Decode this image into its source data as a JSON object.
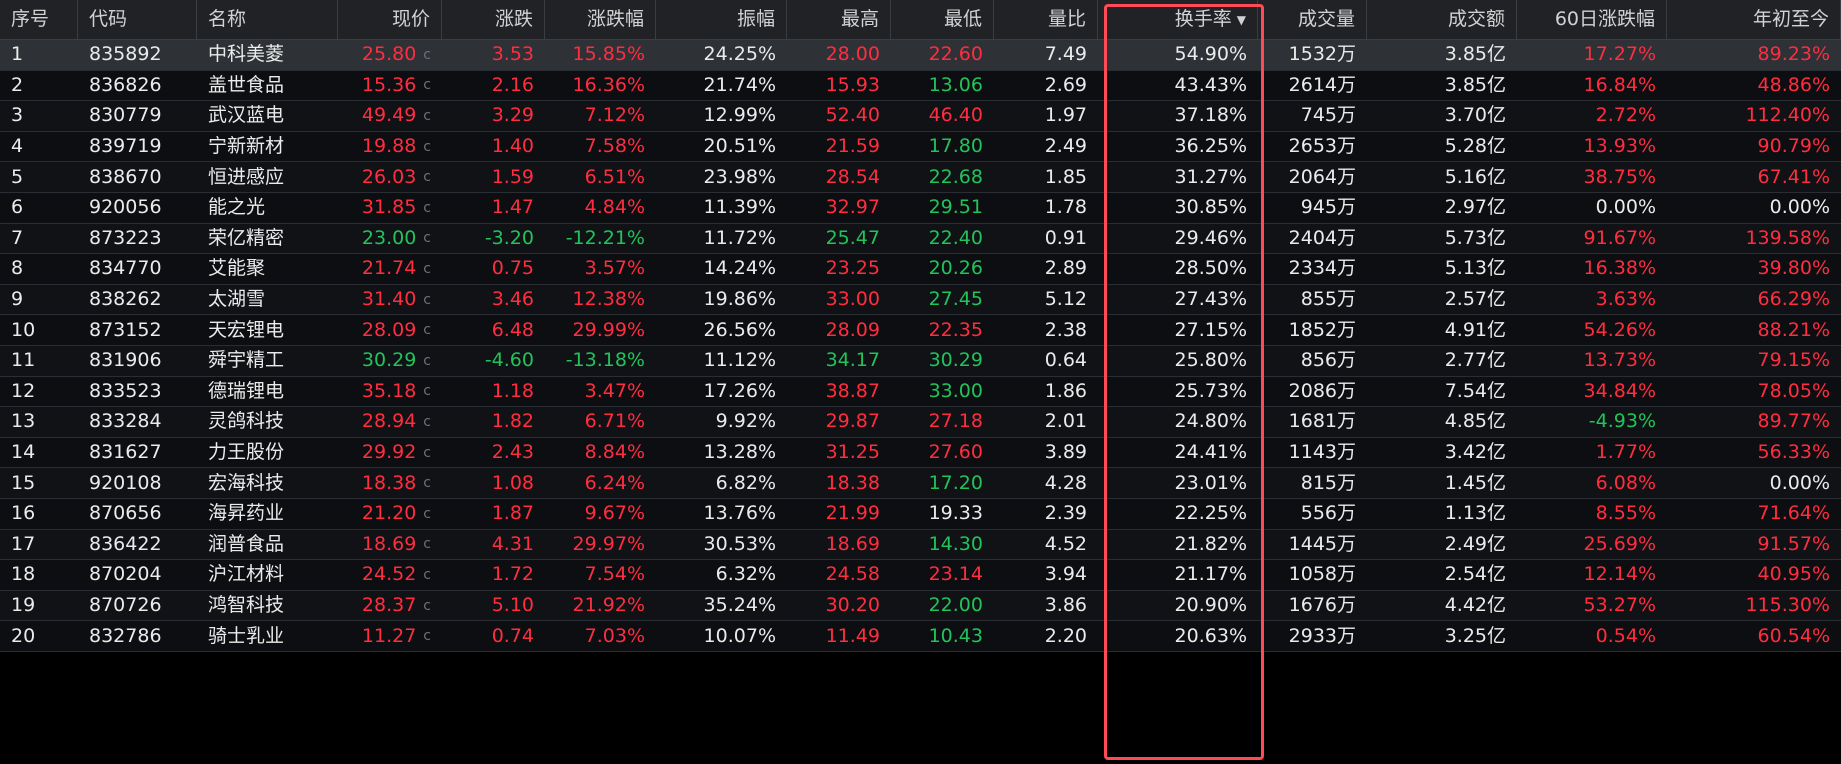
{
  "columns": [
    {
      "key": "seq",
      "label": "序号",
      "align": "l",
      "w": 78
    },
    {
      "key": "code",
      "label": "代码",
      "align": "l",
      "w": 119
    },
    {
      "key": "name",
      "label": "名称",
      "align": "l",
      "w": 141
    },
    {
      "key": "price",
      "label": "现价",
      "align": "r",
      "w": 104
    },
    {
      "key": "chg",
      "label": "涨跌",
      "align": "r",
      "w": 103
    },
    {
      "key": "pct",
      "label": "涨跌幅",
      "align": "r",
      "w": 111
    },
    {
      "key": "amp",
      "label": "振幅",
      "align": "r",
      "w": 131
    },
    {
      "key": "high",
      "label": "最高",
      "align": "r",
      "w": 104
    },
    {
      "key": "low",
      "label": "最低",
      "align": "r",
      "w": 103
    },
    {
      "key": "vr",
      "label": "量比",
      "align": "r",
      "w": 104
    },
    {
      "key": "turn",
      "label": "换手率",
      "align": "r",
      "w": 160,
      "sorted": true,
      "sort_arrow": "▼"
    },
    {
      "key": "vol",
      "label": "成交量",
      "align": "r",
      "w": 109
    },
    {
      "key": "amt",
      "label": "成交额",
      "align": "r",
      "w": 150
    },
    {
      "key": "d60",
      "label": "60日涨跌幅",
      "align": "r",
      "w": 150
    },
    {
      "key": "ytd",
      "label": "年初至今",
      "align": "r",
      "w": 174
    }
  ],
  "price_suffix": "c",
  "selected_row": 0,
  "colors": {
    "up": "#ff2d3f",
    "down": "#21c35a",
    "flat": "#ebebeb",
    "highlight_box": "#ff4a57"
  },
  "rows": [
    {
      "seq": "1",
      "code": "835892",
      "name": "中科美菱",
      "price": "25.80",
      "chg": "3.53",
      "pct": "15.85%",
      "amp": "24.25%",
      "high": "28.00",
      "low": "22.60",
      "vr": "7.49",
      "turn": "54.90%",
      "vol": "1532万",
      "amt": "3.85亿",
      "d60": "17.27%",
      "ytd": "89.23%"
    },
    {
      "seq": "2",
      "code": "836826",
      "name": "盖世食品",
      "price": "15.36",
      "chg": "2.16",
      "pct": "16.36%",
      "amp": "21.74%",
      "high": "15.93",
      "low": "13.06",
      "vr": "2.69",
      "turn": "43.43%",
      "vol": "2614万",
      "amt": "3.85亿",
      "d60": "16.84%",
      "ytd": "48.86%"
    },
    {
      "seq": "3",
      "code": "830779",
      "name": "武汉蓝电",
      "price": "49.49",
      "chg": "3.29",
      "pct": "7.12%",
      "amp": "12.99%",
      "high": "52.40",
      "low": "46.40",
      "vr": "1.97",
      "turn": "37.18%",
      "vol": "745万",
      "amt": "3.70亿",
      "d60": "2.72%",
      "ytd": "112.40%"
    },
    {
      "seq": "4",
      "code": "839719",
      "name": "宁新新材",
      "price": "19.88",
      "chg": "1.40",
      "pct": "7.58%",
      "amp": "20.51%",
      "high": "21.59",
      "low": "17.80",
      "vr": "2.49",
      "turn": "36.25%",
      "vol": "2653万",
      "amt": "5.28亿",
      "d60": "13.93%",
      "ytd": "90.79%"
    },
    {
      "seq": "5",
      "code": "838670",
      "name": "恒进感应",
      "price": "26.03",
      "chg": "1.59",
      "pct": "6.51%",
      "amp": "23.98%",
      "high": "28.54",
      "low": "22.68",
      "vr": "1.85",
      "turn": "31.27%",
      "vol": "2064万",
      "amt": "5.16亿",
      "d60": "38.75%",
      "ytd": "67.41%"
    },
    {
      "seq": "6",
      "code": "920056",
      "name": "能之光",
      "price": "31.85",
      "chg": "1.47",
      "pct": "4.84%",
      "amp": "11.39%",
      "high": "32.97",
      "low": "29.51",
      "vr": "1.78",
      "turn": "30.85%",
      "vol": "945万",
      "amt": "2.97亿",
      "d60": "0.00%",
      "ytd": "0.00%"
    },
    {
      "seq": "7",
      "code": "873223",
      "name": "荣亿精密",
      "price": "23.00",
      "chg": "-3.20",
      "pct": "-12.21%",
      "amp": "11.72%",
      "high": "25.47",
      "low": "22.40",
      "vr": "0.91",
      "turn": "29.46%",
      "vol": "2404万",
      "amt": "5.73亿",
      "d60": "91.67%",
      "ytd": "139.58%"
    },
    {
      "seq": "8",
      "code": "834770",
      "name": "艾能聚",
      "price": "21.74",
      "chg": "0.75",
      "pct": "3.57%",
      "amp": "14.24%",
      "high": "23.25",
      "low": "20.26",
      "vr": "2.89",
      "turn": "28.50%",
      "vol": "2334万",
      "amt": "5.13亿",
      "d60": "16.38%",
      "ytd": "39.80%"
    },
    {
      "seq": "9",
      "code": "838262",
      "name": "太湖雪",
      "price": "31.40",
      "chg": "3.46",
      "pct": "12.38%",
      "amp": "19.86%",
      "high": "33.00",
      "low": "27.45",
      "vr": "5.12",
      "turn": "27.43%",
      "vol": "855万",
      "amt": "2.57亿",
      "d60": "3.63%",
      "ytd": "66.29%"
    },
    {
      "seq": "10",
      "code": "873152",
      "name": "天宏锂电",
      "price": "28.09",
      "chg": "6.48",
      "pct": "29.99%",
      "amp": "26.56%",
      "high": "28.09",
      "low": "22.35",
      "vr": "2.38",
      "turn": "27.15%",
      "vol": "1852万",
      "amt": "4.91亿",
      "d60": "54.26%",
      "ytd": "88.21%"
    },
    {
      "seq": "11",
      "code": "831906",
      "name": "舜宇精工",
      "price": "30.29",
      "chg": "-4.60",
      "pct": "-13.18%",
      "amp": "11.12%",
      "high": "34.17",
      "low": "30.29",
      "vr": "0.64",
      "turn": "25.80%",
      "vol": "856万",
      "amt": "2.77亿",
      "d60": "13.73%",
      "ytd": "79.15%"
    },
    {
      "seq": "12",
      "code": "833523",
      "name": "德瑞锂电",
      "price": "35.18",
      "chg": "1.18",
      "pct": "3.47%",
      "amp": "17.26%",
      "high": "38.87",
      "low": "33.00",
      "vr": "1.86",
      "turn": "25.73%",
      "vol": "2086万",
      "amt": "7.54亿",
      "d60": "34.84%",
      "ytd": "78.05%"
    },
    {
      "seq": "13",
      "code": "833284",
      "name": "灵鸽科技",
      "price": "28.94",
      "chg": "1.82",
      "pct": "6.71%",
      "amp": "9.92%",
      "high": "29.87",
      "low": "27.18",
      "vr": "2.01",
      "turn": "24.80%",
      "vol": "1681万",
      "amt": "4.85亿",
      "d60": "-4.93%",
      "ytd": "89.77%"
    },
    {
      "seq": "14",
      "code": "831627",
      "name": "力王股份",
      "price": "29.92",
      "chg": "2.43",
      "pct": "8.84%",
      "amp": "13.28%",
      "high": "31.25",
      "low": "27.60",
      "vr": "3.89",
      "turn": "24.41%",
      "vol": "1143万",
      "amt": "3.42亿",
      "d60": "1.77%",
      "ytd": "56.33%"
    },
    {
      "seq": "15",
      "code": "920108",
      "name": "宏海科技",
      "price": "18.38",
      "chg": "1.08",
      "pct": "6.24%",
      "amp": "6.82%",
      "high": "18.38",
      "low": "17.20",
      "vr": "4.28",
      "turn": "23.01%",
      "vol": "815万",
      "amt": "1.45亿",
      "d60": "6.08%",
      "ytd": "0.00%"
    },
    {
      "seq": "16",
      "code": "870656",
      "name": "海昇药业",
      "price": "21.20",
      "chg": "1.87",
      "pct": "9.67%",
      "amp": "13.76%",
      "high": "21.99",
      "low": "19.33",
      "vr": "2.39",
      "turn": "22.25%",
      "vol": "556万",
      "amt": "1.13亿",
      "d60": "8.55%",
      "ytd": "71.64%"
    },
    {
      "seq": "17",
      "code": "836422",
      "name": "润普食品",
      "price": "18.69",
      "chg": "4.31",
      "pct": "29.97%",
      "amp": "30.53%",
      "high": "18.69",
      "low": "14.30",
      "vr": "4.52",
      "turn": "21.82%",
      "vol": "1445万",
      "amt": "2.49亿",
      "d60": "25.69%",
      "ytd": "91.57%"
    },
    {
      "seq": "18",
      "code": "870204",
      "name": "沪江材料",
      "price": "24.52",
      "chg": "1.72",
      "pct": "7.54%",
      "amp": "6.32%",
      "high": "24.58",
      "low": "23.14",
      "vr": "3.94",
      "turn": "21.17%",
      "vol": "1058万",
      "amt": "2.54亿",
      "d60": "12.14%",
      "ytd": "40.95%"
    },
    {
      "seq": "19",
      "code": "870726",
      "name": "鸿智科技",
      "price": "28.37",
      "chg": "5.10",
      "pct": "21.92%",
      "amp": "35.24%",
      "high": "30.20",
      "low": "22.00",
      "vr": "3.86",
      "turn": "20.90%",
      "vol": "1676万",
      "amt": "4.42亿",
      "d60": "53.27%",
      "ytd": "115.30%"
    },
    {
      "seq": "20",
      "code": "832786",
      "name": "骑士乳业",
      "price": "11.27",
      "chg": "0.74",
      "pct": "7.03%",
      "amp": "10.07%",
      "high": "11.49",
      "low": "10.43",
      "vr": "2.20",
      "turn": "20.63%",
      "vol": "2933万",
      "amt": "3.25亿",
      "d60": "0.54%",
      "ytd": "60.54%"
    }
  ],
  "colors_by_column": {
    "price": "follow_chg",
    "chg": "sign",
    "pct": "sign",
    "high": "vs_prev",
    "low": "vs_prev",
    "d60": "sign",
    "ytd": "sign"
  }
}
